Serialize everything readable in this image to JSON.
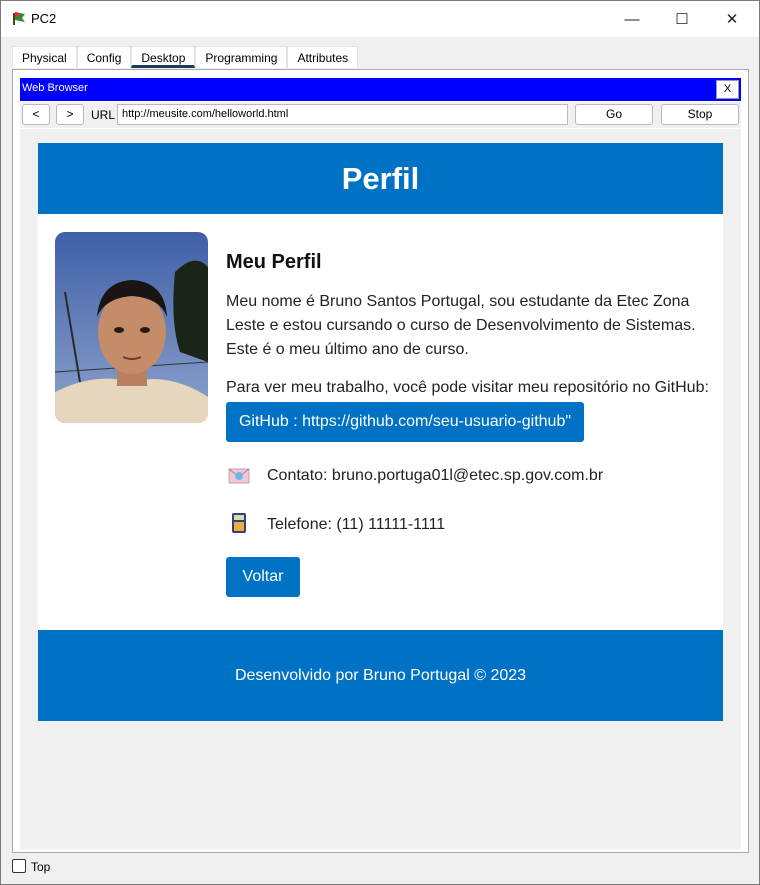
{
  "window": {
    "title": "PC2",
    "minimize": "—",
    "maximize": "☐",
    "close": "✕"
  },
  "tabs": [
    {
      "label": "Physical"
    },
    {
      "label": "Config"
    },
    {
      "label": "Desktop"
    },
    {
      "label": "Programming"
    },
    {
      "label": "Attributes"
    }
  ],
  "browser": {
    "title": "Web Browser",
    "close": "X",
    "back": "<",
    "forward": ">",
    "url_label": "URL",
    "url": "http://meusite.com/helloworld.html",
    "go": "Go",
    "stop": "Stop"
  },
  "page": {
    "header_title": "Perfil",
    "heading": "Meu Perfil",
    "bio": "Meu nome é Bruno Santos Portugal, sou estudante da Etec Zona Leste e estou cursando o curso de Desenvolvimento de Sistemas. Este é o meu último ano de curso.",
    "github_text": "Para ver meu trabalho, você pode visitar meu repositório no GitHub:",
    "github_button": "GitHub : https://github.com/seu-usuario-github\"",
    "contact": "Contato: bruno.portuga01l@etec.sp.gov.com.br",
    "phone": "Telefone: (11) 11111-1111",
    "back_button": "Voltar",
    "footer": "Desenvolvido por Bruno Portugal © 2023"
  },
  "bottom": {
    "top_label": "Top"
  },
  "colors": {
    "accent": "#0072c6",
    "browser_bar": "#0000ff"
  }
}
